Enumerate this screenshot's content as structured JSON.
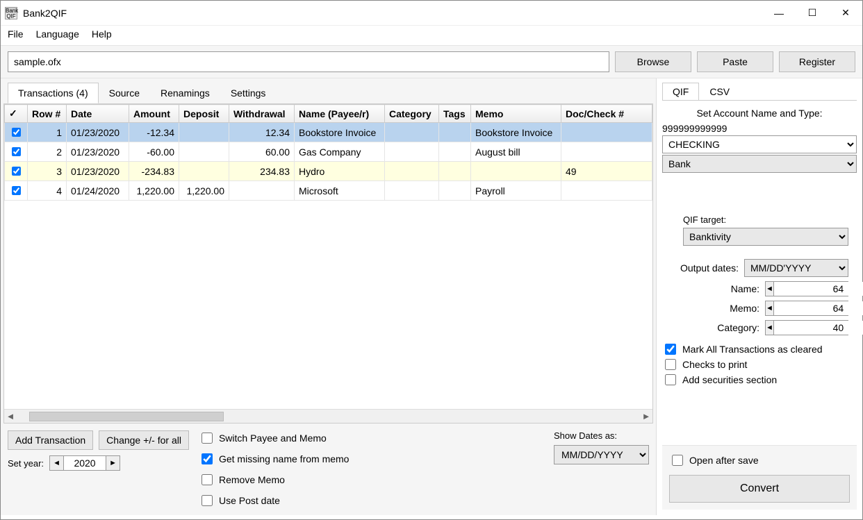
{
  "title": "Bank2QIF",
  "menu": {
    "file": "File",
    "language": "Language",
    "help": "Help"
  },
  "file_input": "sample.ofx",
  "buttons": {
    "browse": "Browse",
    "paste": "Paste",
    "register": "Register"
  },
  "tabs": {
    "transactions": "Transactions (4)",
    "source": "Source",
    "renamings": "Renamings",
    "settings": "Settings"
  },
  "columns": {
    "check": "✓",
    "row": "Row #",
    "date": "Date",
    "amount": "Amount",
    "deposit": "Deposit",
    "withdrawal": "Withdrawal",
    "name": "Name (Payee/r)",
    "category": "Category",
    "tags": "Tags",
    "memo": "Memo",
    "doc": "Doc/Check #"
  },
  "rows": [
    {
      "row": "1",
      "date": "01/23/2020",
      "amount": "-12.34",
      "deposit": "",
      "withdrawal": "12.34",
      "name": "Bookstore Invoice",
      "category": "",
      "tags": "",
      "memo": "Bookstore Invoice",
      "doc": ""
    },
    {
      "row": "2",
      "date": "01/23/2020",
      "amount": "-60.00",
      "deposit": "",
      "withdrawal": "60.00",
      "name": "Gas Company",
      "category": "",
      "tags": "",
      "memo": "August bill",
      "doc": ""
    },
    {
      "row": "3",
      "date": "01/23/2020",
      "amount": "-234.83",
      "deposit": "",
      "withdrawal": "234.83",
      "name": "Hydro",
      "category": "",
      "tags": "",
      "memo": "",
      "doc": "49"
    },
    {
      "row": "4",
      "date": "01/24/2020",
      "amount": "1,220.00",
      "deposit": "1,220.00",
      "withdrawal": "",
      "name": "Microsoft",
      "category": "",
      "tags": "",
      "memo": "Payroll",
      "doc": ""
    }
  ],
  "bottom": {
    "add_transaction": "Add Transaction",
    "change_sign": "Change +/- for all",
    "set_year": "Set year:",
    "year": "2020",
    "switch_payee": "Switch Payee and Memo",
    "get_missing": "Get missing name from memo",
    "remove_memo": "Remove Memo",
    "use_post": "Use Post date",
    "show_dates": "Show Dates as:",
    "show_dates_value": "MM/DD/YYYY"
  },
  "right": {
    "qif_tab": "QIF",
    "csv_tab": "CSV",
    "set_account": "Set Account Name and Type:",
    "account_id": "999999999999",
    "account_name": "CHECKING",
    "account_type": "Bank",
    "qif_target_label": "QIF target:",
    "qif_target": "Banktivity",
    "output_dates_label": "Output dates:",
    "output_dates": "MM/DD'YYYY",
    "name_label": "Name:",
    "name_val": "64",
    "memo_label": "Memo:",
    "memo_val": "64",
    "category_label": "Category:",
    "category_val": "40",
    "mark_cleared": "Mark All Transactions as cleared",
    "checks_print": "Checks to print",
    "add_securities": "Add securities section",
    "open_after": "Open after save",
    "convert": "Convert"
  }
}
